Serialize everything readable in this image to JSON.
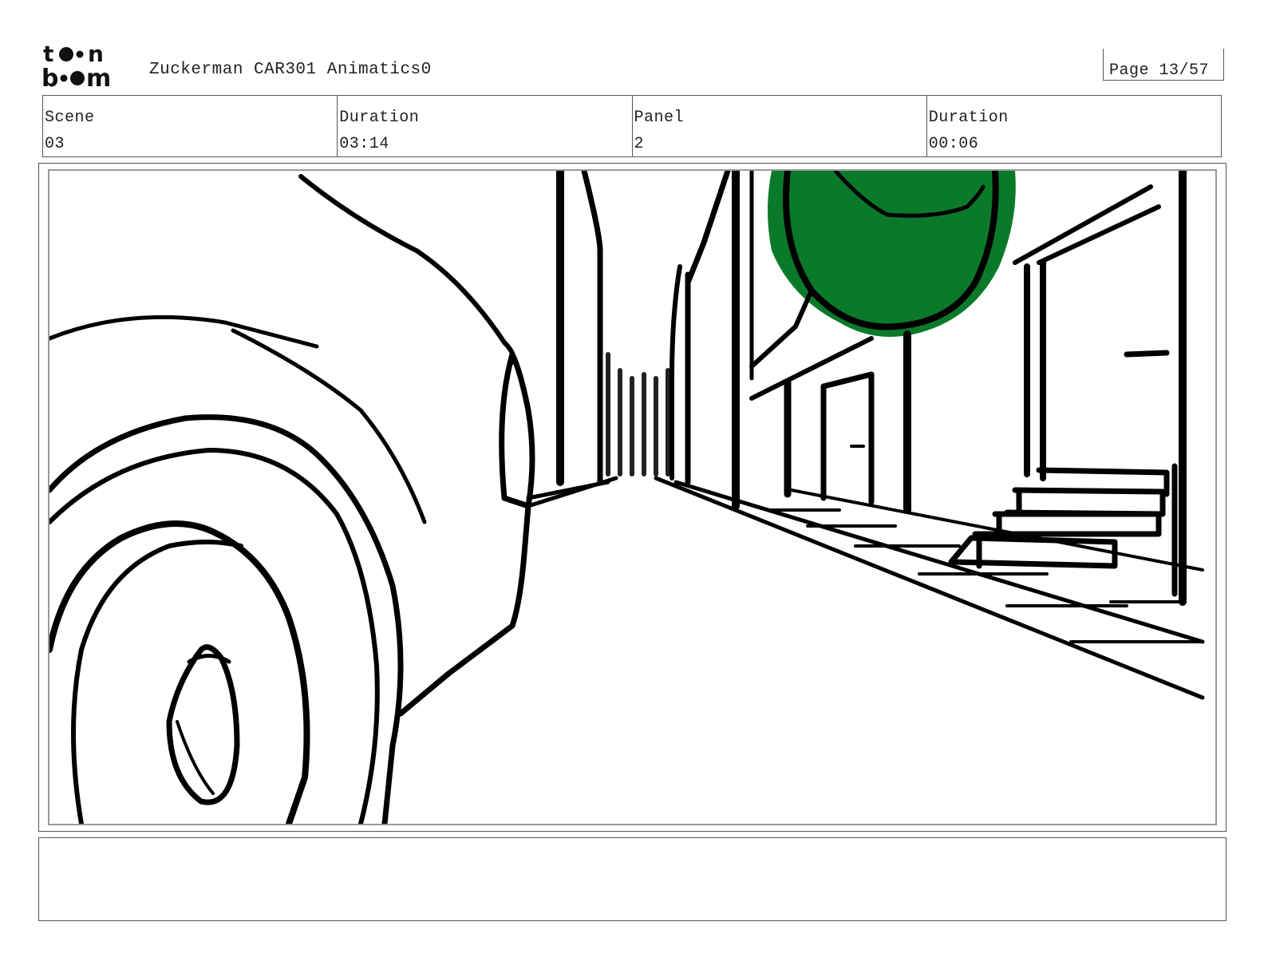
{
  "header": {
    "logo_text": "toon boom",
    "project_title": "Zuckerman CAR301 Animatics0",
    "page_label": "Page 13/57"
  },
  "info": [
    {
      "label": "Scene",
      "value": "03"
    },
    {
      "label": "Duration",
      "value": "03:14"
    },
    {
      "label": "Panel",
      "value": "2"
    },
    {
      "label": "Duration",
      "value": "00:06"
    }
  ],
  "panel": {
    "description_icons": [
      "car-wheel",
      "street",
      "buildings",
      "tree",
      "stairs"
    ],
    "tree_color": "#0a7a2a",
    "line_color": "#000000"
  },
  "caption": {
    "text": ""
  }
}
